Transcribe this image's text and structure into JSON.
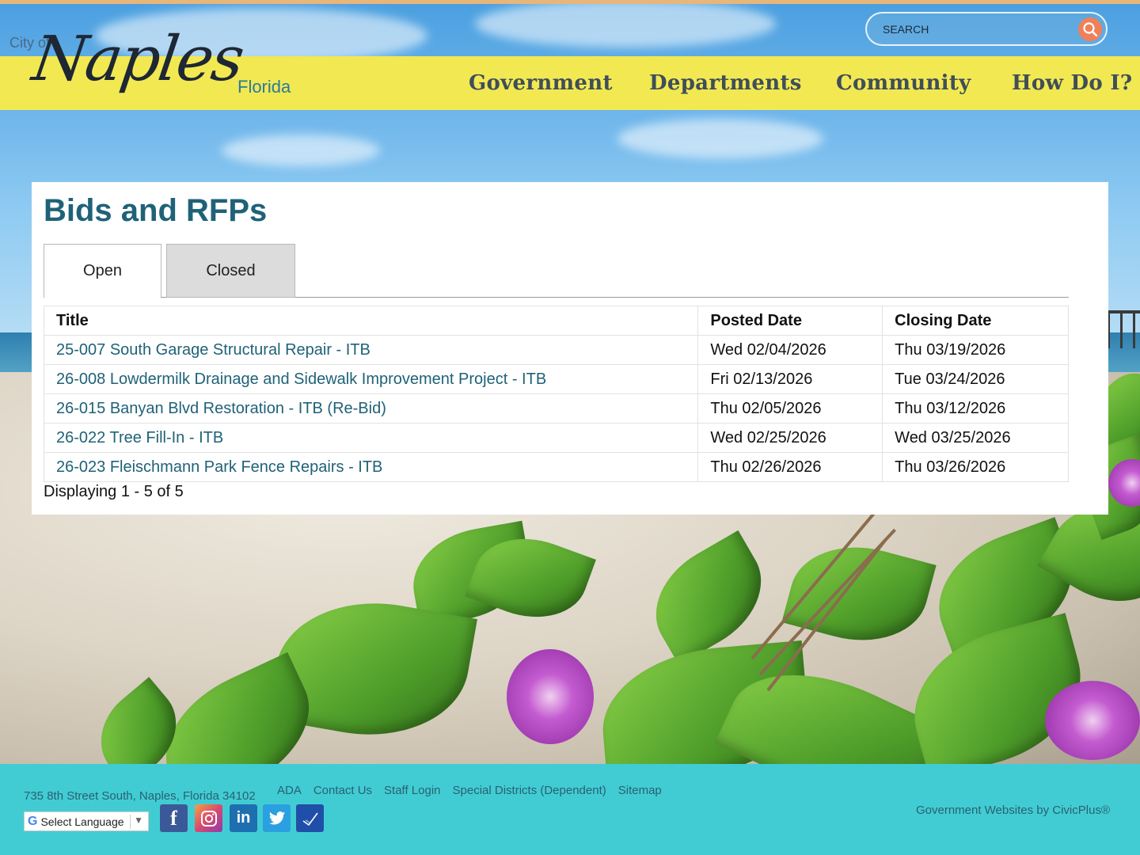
{
  "header": {
    "logo": {
      "prefix": "City of",
      "name": "Naples",
      "suffix": "Florida"
    },
    "search": {
      "placeholder": "SEARCH"
    },
    "nav": [
      "Government",
      "Departments",
      "Community",
      "How Do I?"
    ]
  },
  "main": {
    "title": "Bids and RFPs",
    "tabs": [
      {
        "label": "Open",
        "active": true
      },
      {
        "label": "Closed",
        "active": false
      }
    ],
    "table": {
      "headers": [
        "Title",
        "Posted Date",
        "Closing Date"
      ],
      "rows": [
        {
          "title": "25-007 South Garage Structural Repair - ITB",
          "posted": "Wed 02/04/2026",
          "closing": "Thu 03/19/2026"
        },
        {
          "title": "26-008 Lowdermilk Drainage and Sidewalk Improvement Project - ITB",
          "posted": "Fri 02/13/2026",
          "closing": "Tue 03/24/2026"
        },
        {
          "title": "26-015 Banyan Blvd Restoration - ITB (Re-Bid)",
          "posted": "Thu 02/05/2026",
          "closing": "Thu 03/12/2026"
        },
        {
          "title": "26-022 Tree Fill-In - ITB",
          "posted": "Wed 02/25/2026",
          "closing": "Wed 03/25/2026"
        },
        {
          "title": "26-023 Fleischmann Park Fence Repairs - ITB",
          "posted": "Thu 02/26/2026",
          "closing": "Thu 03/26/2026"
        }
      ]
    },
    "pagination_text": "Displaying 1 - 5 of 5"
  },
  "footer": {
    "address": "735 8th Street South, Naples, Florida 34102",
    "links": [
      "ADA",
      "Contact Us",
      "Staff Login",
      "Special Districts (Dependent)",
      "Sitemap"
    ],
    "language_select": "Select Language",
    "social": [
      {
        "icon": "facebook-icon",
        "glyph": "f",
        "color": "#3b5998"
      },
      {
        "icon": "instagram-icon",
        "glyph": "◎",
        "color": "#d94a6e"
      },
      {
        "icon": "linkedin-icon",
        "glyph": "in",
        "color": "#1e6fb0"
      },
      {
        "icon": "twitter-icon",
        "glyph": "t",
        "color": "#2aa0e0"
      },
      {
        "icon": "notify-me-icon",
        "glyph": "✓",
        "color": "#1f4fa8"
      }
    ],
    "credit": "Government Websites by CivicPlus®"
  },
  "colors": {
    "nav_bar": "#f2e852",
    "title": "#1f6278",
    "link": "#1f6278",
    "footer": "#41ccd4",
    "search_button": "#f0805a"
  }
}
